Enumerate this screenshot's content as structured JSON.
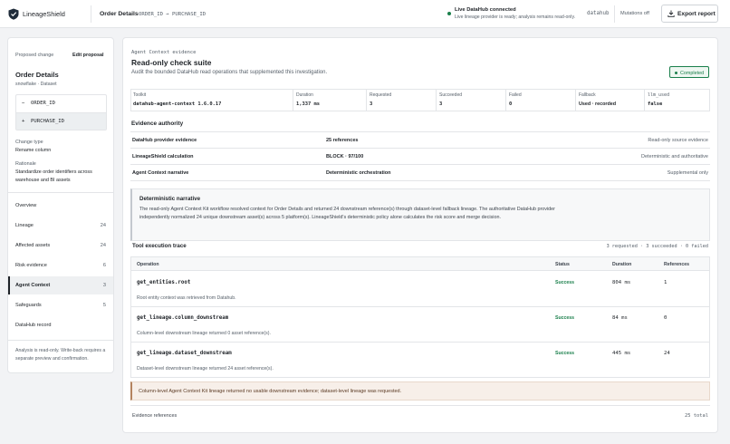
{
  "header": {
    "brand": "LineageShield",
    "page_title": "Order Details",
    "breadcrumb_ids": "ORDER_ID → PURCHASE_ID",
    "live_title": "Live DataHub connected",
    "live_subtitle": "Live lineage provider is ready; analysis remains read-only.",
    "live_host": "datahub",
    "mutations": "Mutations off",
    "export_label": "Export report",
    "colors": {
      "live": "#1a7f4b"
    }
  },
  "sidebar": {
    "proposed_change": "Proposed change",
    "edit_proposal": "Edit proposal",
    "dataset_name": "Order Details",
    "dataset_meta": "snowflake · Dataset",
    "diff": {
      "removed_sign": "−",
      "removed": "ORDER_ID",
      "added_sign": "+",
      "added": "PURCHASE_ID"
    },
    "change_type_label": "Change type",
    "change_type": "Rename column",
    "rationale_label": "Rationale",
    "rationale": "Standardize order identifiers across warehouse and BI assets",
    "nav": [
      {
        "label": "Overview",
        "count": ""
      },
      {
        "label": "Lineage",
        "count": "24"
      },
      {
        "label": "Affected assets",
        "count": "24"
      },
      {
        "label": "Risk evidence",
        "count": "6"
      },
      {
        "label": "Agent Context",
        "count": "3"
      },
      {
        "label": "Safeguards",
        "count": "5"
      },
      {
        "label": "DataHub record",
        "count": ""
      }
    ],
    "footer": "Analysis is read-only. Write-back requires a separate preview and confirmation."
  },
  "main": {
    "eyebrow": "Agent Context evidence",
    "title": "Read-only check suite",
    "subtitle": "Audit the bounded DataHub read operations that supplemented this investigation.",
    "status_badge": "Completed",
    "stats": [
      {
        "label": "Toolkit",
        "value": "datahub-agent-context 1.6.0.17"
      },
      {
        "label": "Duration",
        "value": "1,337 ms"
      },
      {
        "label": "Requested",
        "value": "3"
      },
      {
        "label": "Succeeded",
        "value": "3"
      },
      {
        "label": "Failed",
        "value": "0"
      },
      {
        "label": "Fallback",
        "value": "Used · recorded"
      },
      {
        "label": "llm_used",
        "value": "false"
      }
    ],
    "authority_heading": "Evidence authority",
    "authority": [
      {
        "source": "DataHub provider evidence",
        "detail": "25 references",
        "role": "Read-only source evidence"
      },
      {
        "source": "LineageShield calculation",
        "detail": "BLOCK · 97/100",
        "role": "Deterministic and authoritative"
      },
      {
        "source": "Agent Context narrative",
        "detail": "Deterministic orchestration",
        "role": "Supplemental only"
      }
    ],
    "narrative": {
      "heading": "Deterministic narrative",
      "body": "The read-only Agent Context Kit workflow resolved context for Order Details and returned 24 downstream reference(s) through dataset-level fallback lineage. The authoritative DataHub provider independently normalized 24 unique downstream asset(s) across 5 platform(s). LineageShield's deterministic policy alone calculates the risk score and merge decision."
    },
    "trace": {
      "heading": "Tool execution trace",
      "summary": "3 requested · 3 succeeded · 0 failed",
      "columns": {
        "operation": "Operation",
        "status": "Status",
        "duration": "Duration",
        "references": "References"
      },
      "rows": [
        {
          "op": "get_entities.root",
          "status": "Success",
          "duration": "804 ms",
          "refs": "1",
          "desc": "Root entity context was retrieved from Datahub."
        },
        {
          "op": "get_lineage.column_downstream",
          "status": "Success",
          "duration": "84 ms",
          "refs": "0",
          "desc": "Column-level downstream lineage returned 0 asset reference(s)."
        },
        {
          "op": "get_lineage.dataset_downstream",
          "status": "Success",
          "duration": "445 ms",
          "refs": "24",
          "desc": "Dataset-level downstream lineage returned 24 asset reference(s)."
        }
      ]
    },
    "warning": "Column-level Agent Context Kit lineage returned no usable downstream evidence; dataset-level lineage was requested.",
    "evidence_refs_label": "Evidence references",
    "evidence_refs_total": "25 total"
  }
}
